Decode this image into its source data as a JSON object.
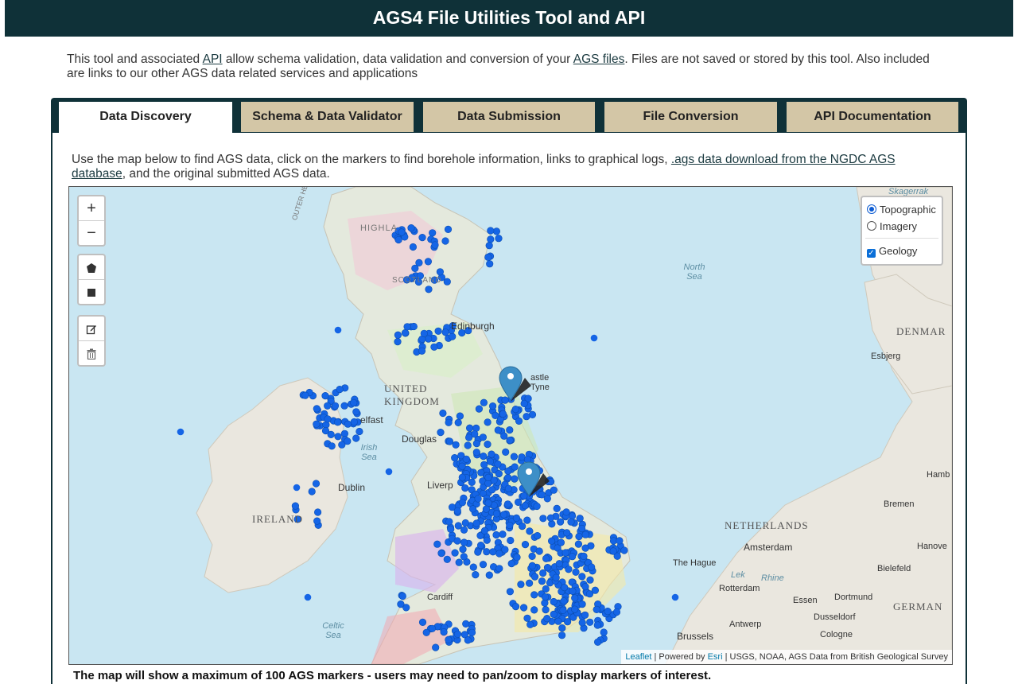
{
  "header": {
    "title": "AGS4 File Utilities Tool and API"
  },
  "intro": {
    "part1": "This tool and associated ",
    "api_link": "API",
    "part2": " allow schema validation, data validation and conversion of your ",
    "ags_link": "AGS files",
    "part3": ". Files are not saved or stored by this tool. Also included are links to our other AGS data related services and applications"
  },
  "tabs": [
    {
      "label": "Data Discovery",
      "active": true
    },
    {
      "label": "Schema & Data Validator",
      "active": false
    },
    {
      "label": "Data Submission",
      "active": false
    },
    {
      "label": "File Conversion",
      "active": false
    },
    {
      "label": "API Documentation",
      "active": false
    }
  ],
  "panel": {
    "desc1": "Use the map below to find AGS data, click on the markers to find borehole information, links to graphical logs, ",
    "desc_link": ".ags data download from the NGDC AGS database",
    "desc2": ", and the original submitted AGS data.",
    "footer_note": "The map will show a maximum of 100 AGS markers - users may need to pan/zoom to display markers of interest."
  },
  "map": {
    "zoom_in": "+",
    "zoom_out": "−",
    "draw_polygon_icon": "polygon-icon",
    "draw_rectangle_icon": "rectangle-icon",
    "edit_icon": "edit-icon",
    "delete_icon": "trash-icon",
    "layers": {
      "topographic": "Topographic",
      "imagery": "Imagery",
      "geology": "Geology",
      "selected_base": "Topographic",
      "geology_checked": true
    },
    "labels": {
      "uk": "UNITED KINGDOM",
      "ireland": "IRELAND",
      "netherlands": "NETHERLANDS",
      "germany": "GERMAN",
      "denmark": "DENMAR",
      "edinburgh": "Edinburgh",
      "belfast": "elfast",
      "dublin": "Dublin",
      "douglas": "Douglas",
      "liverpool": "Liverp",
      "newcastle": "astle Tyne",
      "amsterdam": "Amsterdam",
      "the_hague": "The Hague",
      "rotterdam": "Rotterdam",
      "brussels": "Brussels",
      "antwerp": "Antwerp",
      "bremen": "Bremen",
      "hamburg": "Hamb",
      "hanover": "Hanove",
      "bielefeld": "Bielefeld",
      "essen": "Essen",
      "dortmund": "Dortmund",
      "dusseldorf": "Dusseldorf",
      "cologne": "Cologne",
      "esbjerg": "Esbjerg",
      "north_sea": "North Sea",
      "irish_sea": "Irish Sea",
      "celtic_sea": "Celtic Sea",
      "skagerrak": "Skagerrak",
      "highlands": "HIGHLA",
      "scotland": "SCOTLAND",
      "cardiff": "Cardiff",
      "outer_hebrides": "OUTER HEBRIDES",
      "lake": "Lek",
      "rhine": "Rhine"
    },
    "attribution": {
      "leaflet": "Leaflet",
      "powered": " | Powered by ",
      "esri": "Esri",
      "sources": " | USGS, NOAA, AGS Data from British Geological Survey"
    },
    "colors": {
      "sea": "#c9e6f2",
      "land": "#eae7df",
      "marker": "#1565e6",
      "pin": "#3d8fc7",
      "header": "#0f3138",
      "tab": "#d3c6a6"
    }
  }
}
